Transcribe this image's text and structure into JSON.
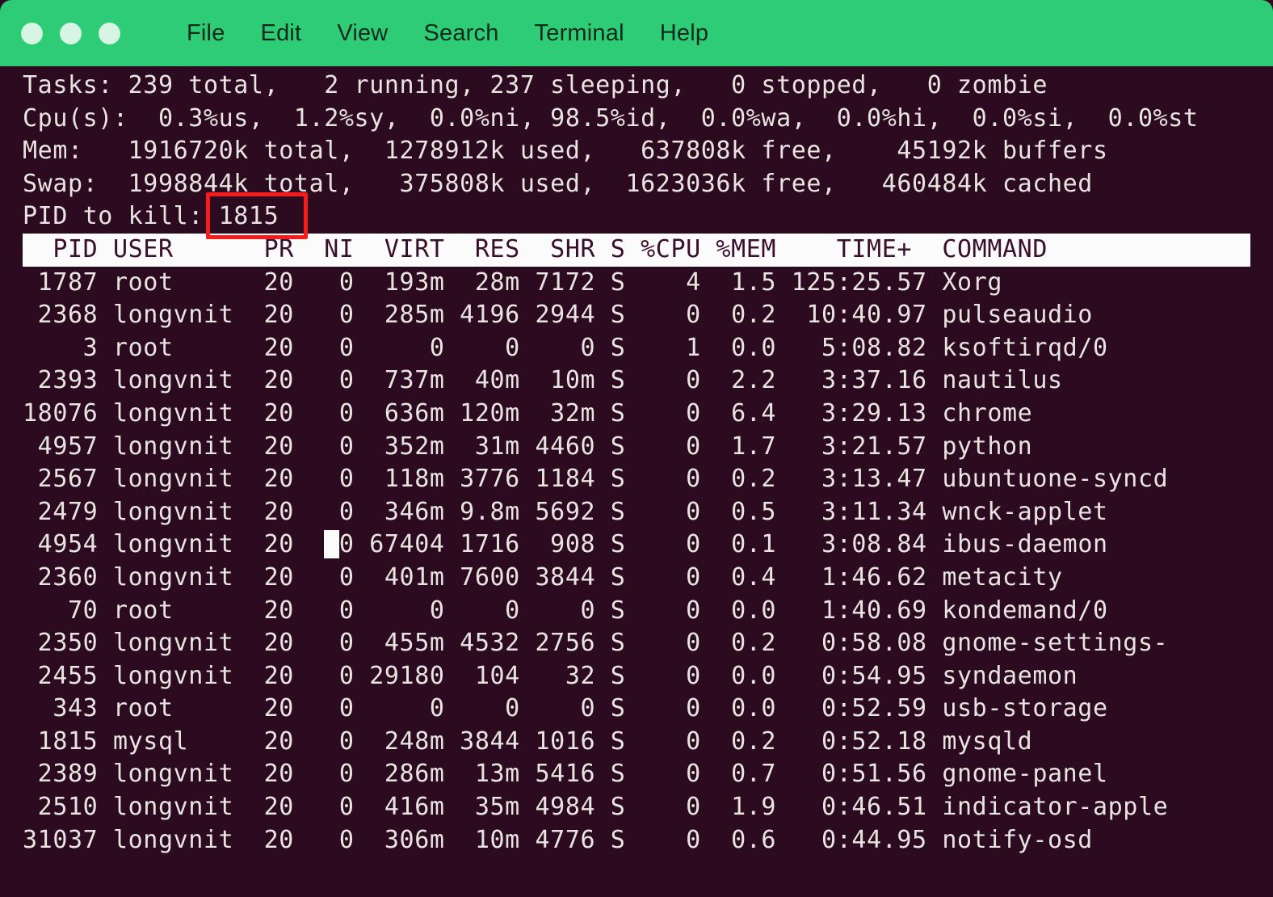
{
  "window": {
    "titlebar_color": "#2ecc77",
    "terminal_bg": "#2c0a20",
    "terminal_fg": "#e8e4e0",
    "highlight_color": "#f71b1b"
  },
  "titlebar": {
    "controls": [
      {
        "name": "close-button",
        "label": ""
      },
      {
        "name": "minimize-button",
        "label": ""
      },
      {
        "name": "maximize-button",
        "label": ""
      }
    ],
    "menus": [
      {
        "label": "File"
      },
      {
        "label": "Edit"
      },
      {
        "label": "View"
      },
      {
        "label": "Search"
      },
      {
        "label": "Terminal"
      },
      {
        "label": "Help"
      }
    ]
  },
  "summary": {
    "tasks_line": "Tasks: 239 total,   2 running, 237 sleeping,   0 stopped,   0 zombie",
    "cpu_line": "Cpu(s):  0.3%us,  1.2%sy,  0.0%ni, 98.5%id,  0.0%wa,  0.0%hi,  0.0%si,  0.0%st",
    "mem_line": "Mem:   1916720k total,  1278912k used,   637808k free,    45192k buffers",
    "swap_line": "Swap:  1998844k total,   375808k used,  1623036k free,   460484k cached",
    "tasks": {
      "total": "239",
      "running": "2",
      "sleeping": "237",
      "stopped": "0",
      "zombie": "0"
    },
    "cpu": {
      "us": "0.3",
      "sy": "1.2",
      "ni": "0.0",
      "id": "98.5",
      "wa": "0.0",
      "hi": "0.0",
      "si": "0.0",
      "st": "0.0"
    },
    "mem": {
      "total": "1916720k",
      "used": "1278912k",
      "free": "637808k",
      "buffers": "45192k"
    },
    "swap": {
      "total": "1998844k",
      "used": "375808k",
      "free": "1623036k",
      "cached": "460484k"
    }
  },
  "prompt": {
    "label": "PID to kill:",
    "value": "1815",
    "full_line": "PID to kill: 1815"
  },
  "table": {
    "header_line": "  PID USER      PR  NI  VIRT  RES  SHR S %CPU %MEM    TIME+  COMMAND",
    "columns": [
      "PID",
      "USER",
      "PR",
      "NI",
      "VIRT",
      "RES",
      "SHR",
      "S",
      "%CPU",
      "%MEM",
      "TIME+",
      "COMMAND"
    ],
    "rows": [
      {
        "line": " 1787 root      20   0  193m  28m 7172 S    4  1.5 125:25.57 Xorg",
        "pid": "1787",
        "user": "root",
        "pr": "20",
        "ni": "0",
        "virt": "193m",
        "res": "28m",
        "shr": "7172",
        "s": "S",
        "cpu": "4",
        "mem": "1.5",
        "time": "125:25.57",
        "command": "Xorg"
      },
      {
        "line": " 2368 longvnit  20   0  285m 4196 2944 S    0  0.2  10:40.97 pulseaudio",
        "pid": "2368",
        "user": "longvnit",
        "pr": "20",
        "ni": "0",
        "virt": "285m",
        "res": "4196",
        "shr": "2944",
        "s": "S",
        "cpu": "0",
        "mem": "0.2",
        "time": "10:40.97",
        "command": "pulseaudio"
      },
      {
        "line": "    3 root      20   0     0    0    0 S    1  0.0   5:08.82 ksoftirqd/0",
        "pid": "3",
        "user": "root",
        "pr": "20",
        "ni": "0",
        "virt": "0",
        "res": "0",
        "shr": "0",
        "s": "S",
        "cpu": "1",
        "mem": "0.0",
        "time": "5:08.82",
        "command": "ksoftirqd/0"
      },
      {
        "line": " 2393 longvnit  20   0  737m  40m  10m S    0  2.2   3:37.16 nautilus",
        "pid": "2393",
        "user": "longvnit",
        "pr": "20",
        "ni": "0",
        "virt": "737m",
        "res": "40m",
        "shr": "10m",
        "s": "S",
        "cpu": "0",
        "mem": "2.2",
        "time": "3:37.16",
        "command": "nautilus"
      },
      {
        "line": "18076 longvnit  20   0  636m 120m  32m S    0  6.4   3:29.13 chrome",
        "pid": "18076",
        "user": "longvnit",
        "pr": "20",
        "ni": "0",
        "virt": "636m",
        "res": "120m",
        "shr": "32m",
        "s": "S",
        "cpu": "0",
        "mem": "6.4",
        "time": "3:29.13",
        "command": "chrome"
      },
      {
        "line": " 4957 longvnit  20   0  352m  31m 4460 S    0  1.7   3:21.57 python",
        "pid": "4957",
        "user": "longvnit",
        "pr": "20",
        "ni": "0",
        "virt": "352m",
        "res": "31m",
        "shr": "4460",
        "s": "S",
        "cpu": "0",
        "mem": "1.7",
        "time": "3:21.57",
        "command": "python"
      },
      {
        "line": " 2567 longvnit  20   0  118m 3776 1184 S    0  0.2   3:13.47 ubuntuone-syncd",
        "pid": "2567",
        "user": "longvnit",
        "pr": "20",
        "ni": "0",
        "virt": "118m",
        "res": "3776",
        "shr": "1184",
        "s": "S",
        "cpu": "0",
        "mem": "0.2",
        "time": "3:13.47",
        "command": "ubuntuone-syncd"
      },
      {
        "line": " 2479 longvnit  20   0  346m 9.8m 5692 S    0  0.5   3:11.34 wnck-applet",
        "pid": "2479",
        "user": "longvnit",
        "pr": "20",
        "ni": "0",
        "virt": "346m",
        "res": "9.8m",
        "shr": "5692",
        "s": "S",
        "cpu": "0",
        "mem": "0.5",
        "time": "3:11.34",
        "command": "wnck-applet"
      },
      {
        "line": " 4954 longvnit  20   0 67404 1716  908 S    0  0.1   3:08.84 ibus-daemon",
        "pid": "4954",
        "user": "longvnit",
        "pr": "20",
        "ni": "0",
        "virt": "67404",
        "res": "1716",
        "shr": "908",
        "s": "S",
        "cpu": "0",
        "mem": "0.1",
        "time": "3:08.84",
        "command": "ibus-daemon",
        "cursor_at": 20
      },
      {
        "line": " 2360 longvnit  20   0  401m 7600 3844 S    0  0.4   1:46.62 metacity",
        "pid": "2360",
        "user": "longvnit",
        "pr": "20",
        "ni": "0",
        "virt": "401m",
        "res": "7600",
        "shr": "3844",
        "s": "S",
        "cpu": "0",
        "mem": "0.4",
        "time": "1:46.62",
        "command": "metacity"
      },
      {
        "line": "   70 root      20   0     0    0    0 S    0  0.0   1:40.69 kondemand/0",
        "pid": "70",
        "user": "root",
        "pr": "20",
        "ni": "0",
        "virt": "0",
        "res": "0",
        "shr": "0",
        "s": "S",
        "cpu": "0",
        "mem": "0.0",
        "time": "1:40.69",
        "command": "kondemand/0"
      },
      {
        "line": " 2350 longvnit  20   0  455m 4532 2756 S    0  0.2   0:58.08 gnome-settings-",
        "pid": "2350",
        "user": "longvnit",
        "pr": "20",
        "ni": "0",
        "virt": "455m",
        "res": "4532",
        "shr": "2756",
        "s": "S",
        "cpu": "0",
        "mem": "0.2",
        "time": "0:58.08",
        "command": "gnome-settings-"
      },
      {
        "line": " 2455 longvnit  20   0 29180  104   32 S    0  0.0   0:54.95 syndaemon",
        "pid": "2455",
        "user": "longvnit",
        "pr": "20",
        "ni": "0",
        "virt": "29180",
        "res": "104",
        "shr": "32",
        "s": "S",
        "cpu": "0",
        "mem": "0.0",
        "time": "0:54.95",
        "command": "syndaemon"
      },
      {
        "line": "  343 root      20   0     0    0    0 S    0  0.0   0:52.59 usb-storage",
        "pid": "343",
        "user": "root",
        "pr": "20",
        "ni": "0",
        "virt": "0",
        "res": "0",
        "shr": "0",
        "s": "S",
        "cpu": "0",
        "mem": "0.0",
        "time": "0:52.59",
        "command": "usb-storage"
      },
      {
        "line": " 1815 mysql     20   0  248m 3844 1016 S    0  0.2   0:52.18 mysqld",
        "pid": "1815",
        "user": "mysql",
        "pr": "20",
        "ni": "0",
        "virt": "248m",
        "res": "3844",
        "shr": "1016",
        "s": "S",
        "cpu": "0",
        "mem": "0.2",
        "time": "0:52.18",
        "command": "mysqld"
      },
      {
        "line": " 2389 longvnit  20   0  286m  13m 5416 S    0  0.7   0:51.56 gnome-panel",
        "pid": "2389",
        "user": "longvnit",
        "pr": "20",
        "ni": "0",
        "virt": "286m",
        "res": "13m",
        "shr": "5416",
        "s": "S",
        "cpu": "0",
        "mem": "0.7",
        "time": "0:51.56",
        "command": "gnome-panel"
      },
      {
        "line": " 2510 longvnit  20   0  416m  35m 4984 S    0  1.9   0:46.51 indicator-apple",
        "pid": "2510",
        "user": "longvnit",
        "pr": "20",
        "ni": "0",
        "virt": "416m",
        "res": "35m",
        "shr": "4984",
        "s": "S",
        "cpu": "0",
        "mem": "1.9",
        "time": "0:46.51",
        "command": "indicator-apple"
      },
      {
        "line": "31037 longvnit  20   0  306m  10m 4776 S    0  0.6   0:44.95 notify-osd",
        "pid": "31037",
        "user": "longvnit",
        "pr": "20",
        "ni": "0",
        "virt": "306m",
        "res": "10m",
        "shr": "4776",
        "s": "S",
        "cpu": "0",
        "mem": "0.6",
        "time": "0:44.95",
        "command": "notify-osd"
      }
    ]
  }
}
